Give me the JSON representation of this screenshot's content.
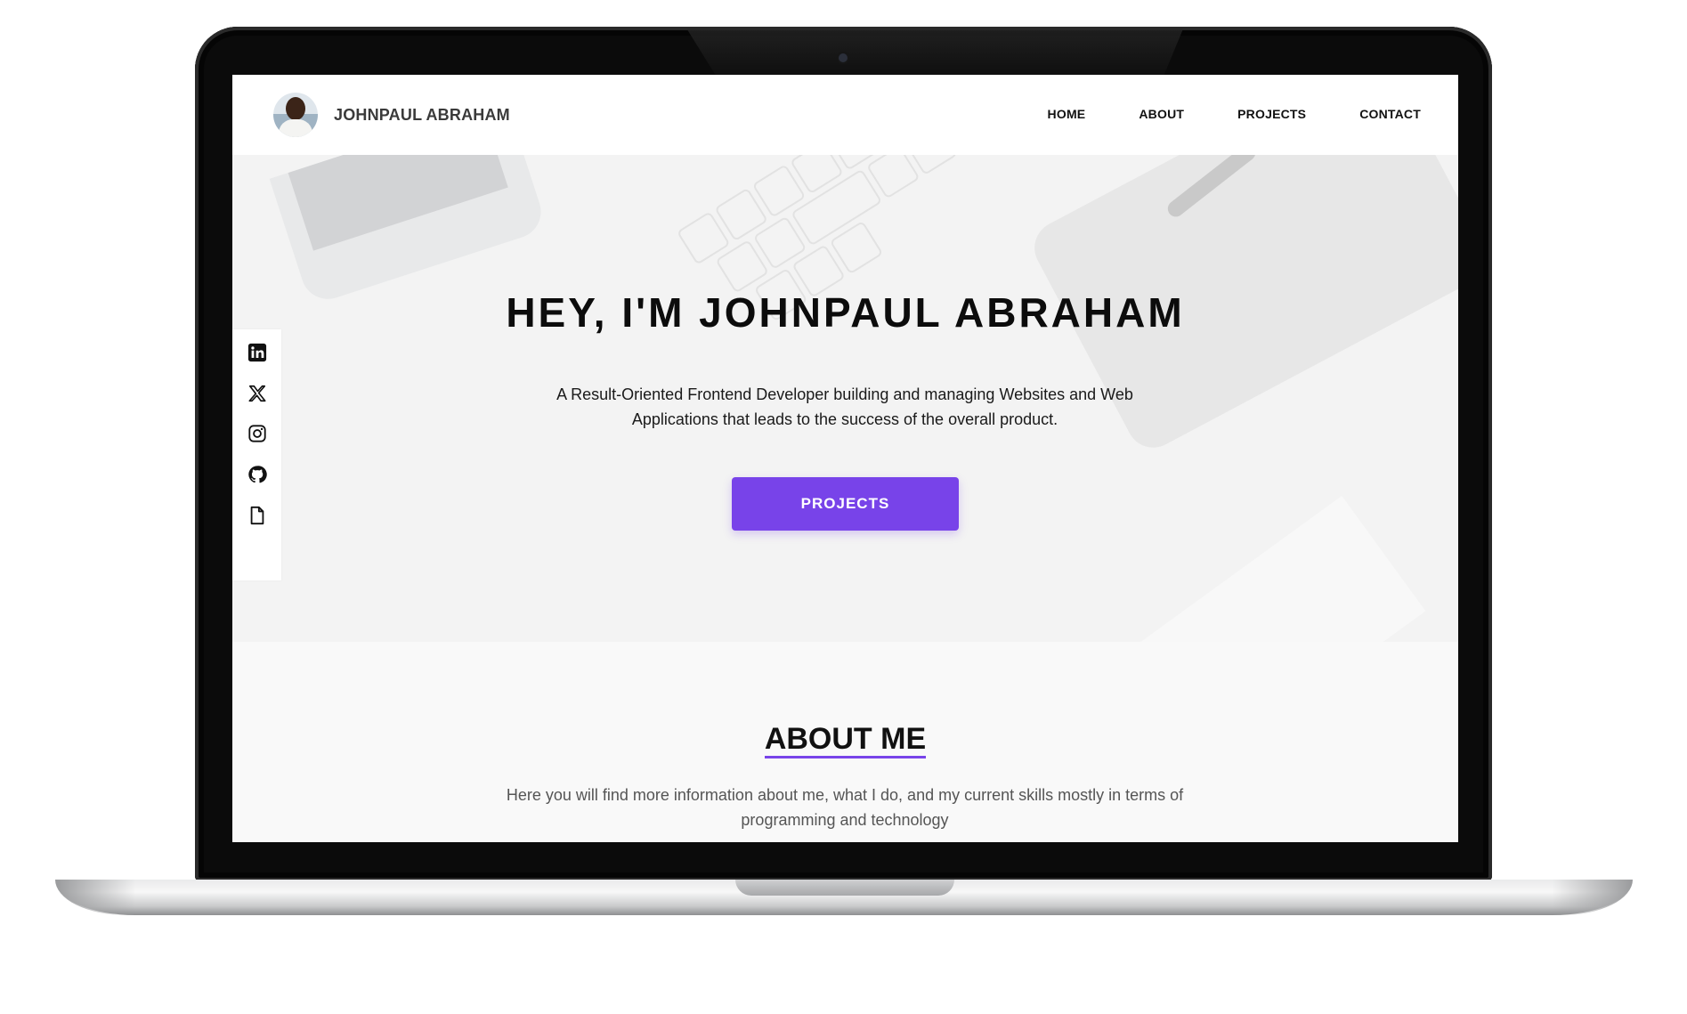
{
  "brand": {
    "name": "JOHNPAUL ABRAHAM"
  },
  "nav": {
    "items": [
      "HOME",
      "ABOUT",
      "PROJECTS",
      "CONTACT"
    ]
  },
  "social": {
    "icons": [
      "linkedin-icon",
      "x-twitter-icon",
      "instagram-icon",
      "github-icon",
      "resume-file-icon"
    ]
  },
  "hero": {
    "title": "HEY, I'M JOHNPAUL ABRAHAM",
    "subtitle": "A Result-Oriented Frontend Developer building and managing Websites and Web Applications that leads to the success of the overall product.",
    "button_label": "PROJECTS"
  },
  "about": {
    "title": "ABOUT ME",
    "text": "Here you will find more information about me, what I do, and my current skills mostly in terms of programming and technology"
  },
  "colors": {
    "accent": "#7843e9",
    "hero_bg": "#f3f3f3",
    "frame": "#0b0b0b"
  }
}
